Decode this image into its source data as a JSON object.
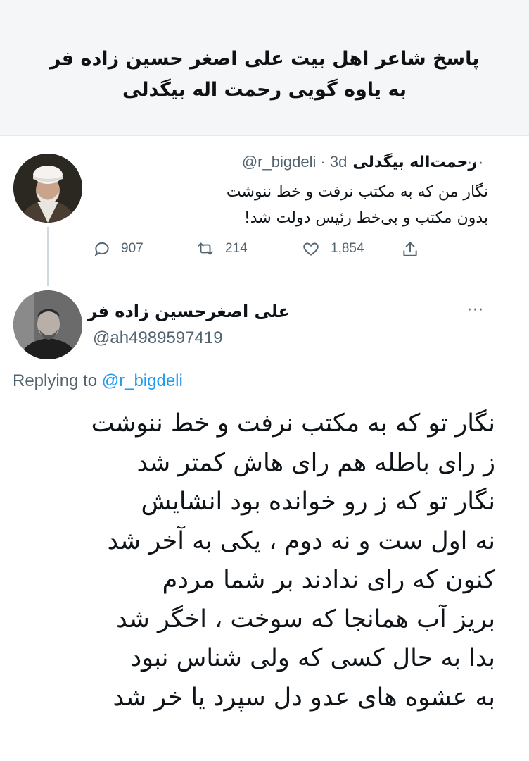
{
  "header": {
    "title_line1": "پاسخ شاعر اهل بیت علی اصغر حسین زاده فر",
    "title_line2": "به یاوه گویی رحمت اله بیگدلی"
  },
  "original_tweet": {
    "author_name": "رحمت‌اله بیگدلی",
    "handle_time": "@r_bigdeli · 3d",
    "more": "···",
    "text_line1": "نگار من که به مکتب نرفت و خط ننوشت",
    "text_line2": "بدون مکتب و  بی‌خط رئیس دولت شد!",
    "replies": "907",
    "retweets": "214",
    "likes": "1,854",
    "icons": [
      "reply-icon",
      "retweet-icon",
      "like-icon",
      "share-icon"
    ]
  },
  "reply_tweet": {
    "author_name": "علی اصغرحسین زاده فر",
    "handle": "@ah4989597419",
    "more": "···",
    "replying_prefix": "Replying to",
    "replying_mention": "@r_bigdeli",
    "poem": [
      "نگار تو که به مکتب نرفت و خط ننوشت",
      "ز رای باطله هم رای هاش کمتر شد",
      "نگار تو که ز رو خوانده بود انشایش",
      "نه اول ست و نه دوم ، یکی به آخر شد",
      "کنون که رای ندادند بر شما مردم",
      "بریز آب همانجا که سوخت ، اخگر شد",
      "بدا به حال کسی که ولی شناس نبود",
      "به عشوه های عدو دل سپرد یا خر شد"
    ]
  },
  "colors": {
    "text": "#0f1419",
    "secondary": "#536471",
    "link": "#1d9bf0",
    "header_bg": "#f5f6f8"
  }
}
